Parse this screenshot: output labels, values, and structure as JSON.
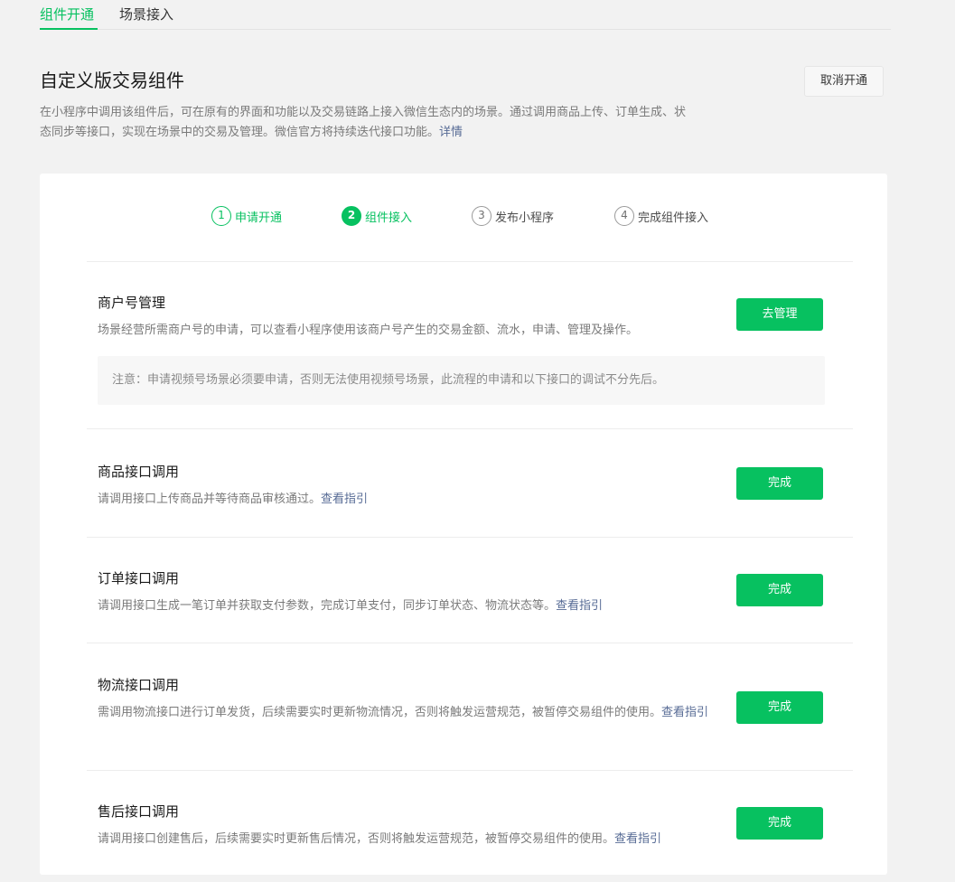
{
  "tabs": [
    {
      "label": "组件开通"
    },
    {
      "label": "场景接入"
    }
  ],
  "header": {
    "title": "自定义版交易组件",
    "cancel_label": "取消开通",
    "description_line1": "在小程序中调用该组件后，可在原有的界面和功能以及交易链路上接入微信生态内的场景。通过调用商品上传、订单生成、状",
    "description_line2": "态同步等接口，实现在场景中的交易及管理。微信官方将持续迭代接口功能。",
    "detail_link": "详情"
  },
  "steps": [
    {
      "number": "1",
      "label": "申请开通",
      "state": "done"
    },
    {
      "number": "2",
      "label": "组件接入",
      "state": "active"
    },
    {
      "number": "3",
      "label": "发布小程序",
      "state": "pending"
    },
    {
      "number": "4",
      "label": "完成组件接入",
      "state": "pending"
    }
  ],
  "sections": {
    "merchant": {
      "title": "商户号管理",
      "desc": "场景经营所需商户号的申请，可以查看小程序使用该商户号产生的交易金额、流水，申请、管理及操作。",
      "notice": "注意：申请视频号场景必须要申请，否则无法使用视频号场景，此流程的申请和以下接口的调试不分先后。",
      "button": "去管理"
    },
    "product": {
      "title": "商品接口调用",
      "desc": "请调用接口上传商品并等待商品审核通过。",
      "link": "查看指引",
      "button": "完成"
    },
    "order": {
      "title": "订单接口调用",
      "desc": "请调用接口生成一笔订单并获取支付参数，完成订单支付，同步订单状态、物流状态等。",
      "link": "查看指引",
      "button": "完成"
    },
    "logistics": {
      "title": "物流接口调用",
      "desc": "需调用物流接口进行订单发货，后续需要实时更新物流情况，否则将触发运营规范，被暂停交易组件的使用。",
      "link": "查看指引",
      "button": "完成"
    },
    "aftersale": {
      "title": "售后接口调用",
      "desc": "请调用接口创建售后，后续需要实时更新售后情况，否则将触发运营规范，被暂停交易组件的使用。",
      "link": "查看指引",
      "button": "完成"
    }
  },
  "colors": {
    "accent": "#07c160",
    "link": "#576b95",
    "background": "#f2f2f2"
  }
}
